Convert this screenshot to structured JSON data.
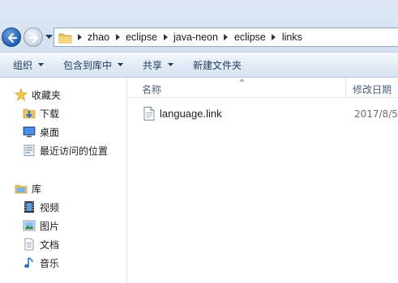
{
  "address_bar": {
    "path": [
      "zhao",
      "eclipse",
      "java-neon",
      "eclipse",
      "links"
    ]
  },
  "toolbar": {
    "organize": "组织",
    "include_in_library": "包含到库中",
    "share": "共享",
    "new_folder": "新建文件夹"
  },
  "nav": {
    "favorites": "收藏夹",
    "downloads": "下载",
    "desktop": "桌面",
    "recent_places": "最近访问的位置",
    "libraries": "库",
    "videos": "视频",
    "pictures": "图片",
    "documents": "文档",
    "music": "音乐"
  },
  "columns": {
    "name": "名称",
    "date_modified": "修改日期"
  },
  "files": [
    {
      "name": "language.link",
      "date": "2017/8/5"
    }
  ],
  "colors": {
    "accent": "#1f5fb4",
    "toolbar_text": "#1e395b",
    "header_text": "#4c607a"
  }
}
